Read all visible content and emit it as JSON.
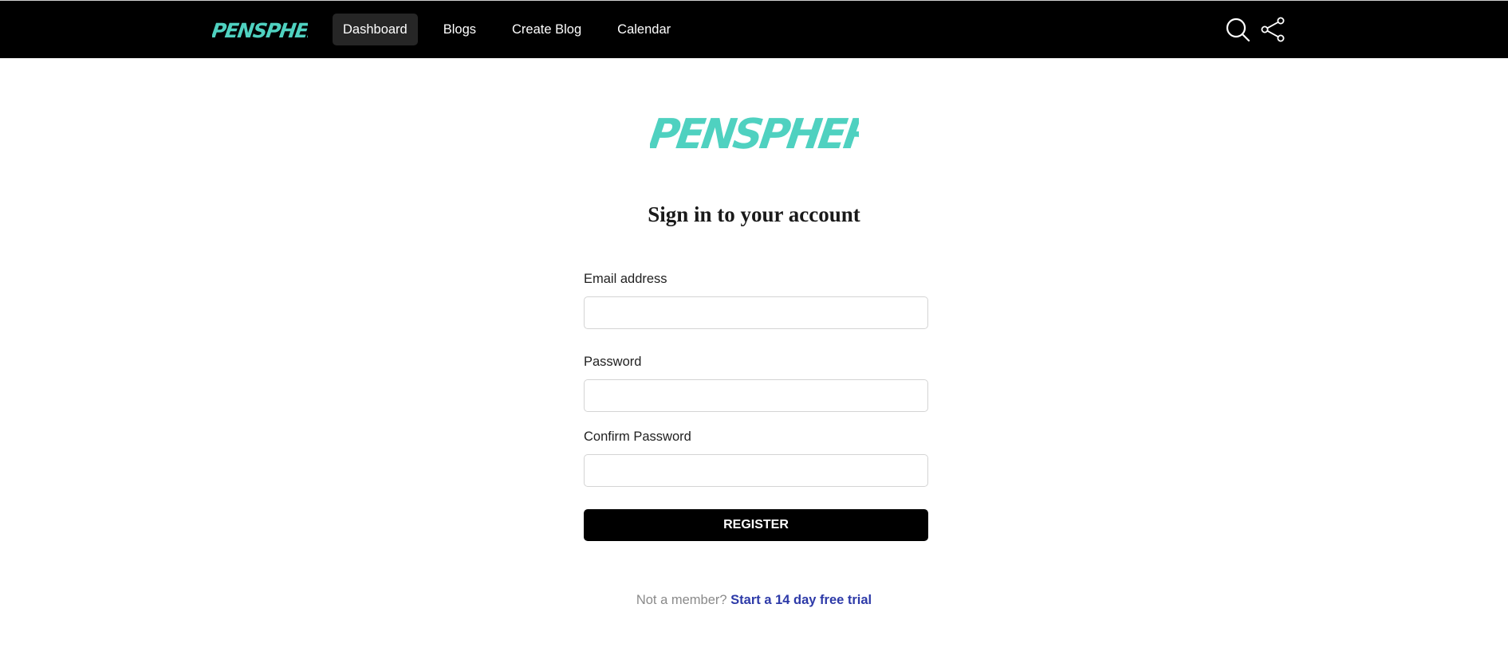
{
  "brand": {
    "name": "PENSPHERE",
    "color": "#4fd1c0"
  },
  "nav": {
    "links": [
      {
        "label": "Dashboard",
        "active": true
      },
      {
        "label": "Blogs",
        "active": false
      },
      {
        "label": "Create Blog",
        "active": false
      },
      {
        "label": "Calendar",
        "active": false
      }
    ],
    "icons": [
      "search-icon",
      "share-icon"
    ]
  },
  "form": {
    "heading": "Sign in to your account",
    "email_label": "Email address",
    "email_value": "",
    "password_label": "Password",
    "password_value": "",
    "confirm_label": "Confirm Password",
    "confirm_value": "",
    "submit_label": "REGISTER"
  },
  "footer": {
    "prompt": "Not a member?",
    "link_label": "Start a 14 day free trial",
    "link_color": "#2d3aa8"
  }
}
